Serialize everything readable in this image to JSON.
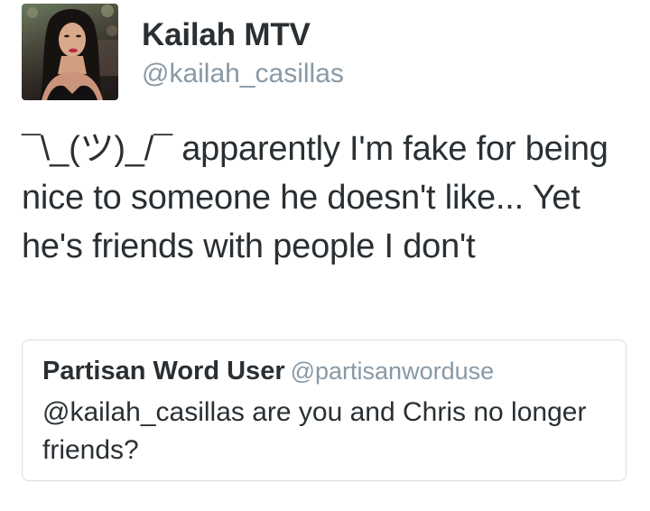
{
  "author": {
    "display_name": "Kailah MTV",
    "handle": "@kailah_casillas",
    "avatar_icon": "profile-photo"
  },
  "tweet": {
    "text": "¯\\_(ツ)_/¯ apparently I'm fake for being nice to someone he doesn't like... Yet he's friends with people I don't"
  },
  "quoted_tweet": {
    "display_name": "Partisan Word User",
    "handle": "@partisanworduse",
    "text": "@kailah_casillas are you and Chris no longer friends?"
  },
  "colors": {
    "text": "#292f33",
    "secondary": "#8899a6",
    "border": "#d7dde2",
    "background": "#ffffff"
  }
}
